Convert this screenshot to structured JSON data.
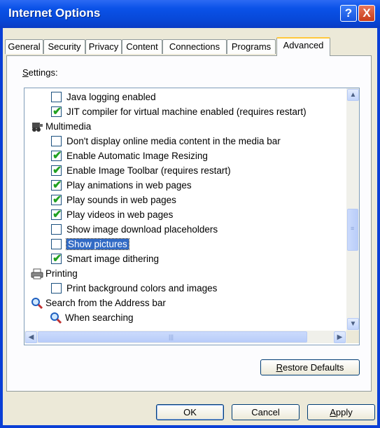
{
  "window": {
    "title": "Internet Options"
  },
  "titlebar_buttons": {
    "help": "?",
    "close": "X"
  },
  "tabs": [
    {
      "label": "General"
    },
    {
      "label": "Security"
    },
    {
      "label": "Privacy"
    },
    {
      "label": "Content"
    },
    {
      "label": "Connections"
    },
    {
      "label": "Programs"
    },
    {
      "label": "Advanced",
      "active": true
    }
  ],
  "settings_label": {
    "mnemonic": "S",
    "rest": "ettings:"
  },
  "tree": [
    {
      "type": "checkbox",
      "label": "Java logging enabled",
      "checked": false
    },
    {
      "type": "checkbox",
      "label": "JIT compiler for virtual machine enabled (requires restart)",
      "checked": true
    },
    {
      "type": "category",
      "label": "Multimedia",
      "icon": "multimedia-icon"
    },
    {
      "type": "checkbox",
      "label": "Don't display online media content in the media bar",
      "checked": false
    },
    {
      "type": "checkbox",
      "label": "Enable Automatic Image Resizing",
      "checked": true
    },
    {
      "type": "checkbox",
      "label": "Enable Image Toolbar (requires restart)",
      "checked": true
    },
    {
      "type": "checkbox",
      "label": "Play animations in web pages",
      "checked": true
    },
    {
      "type": "checkbox",
      "label": "Play sounds in web pages",
      "checked": true
    },
    {
      "type": "checkbox",
      "label": "Play videos in web pages",
      "checked": true
    },
    {
      "type": "checkbox",
      "label": "Show image download placeholders",
      "checked": false
    },
    {
      "type": "checkbox",
      "label": "Show pictures",
      "checked": false,
      "selected": true
    },
    {
      "type": "checkbox",
      "label": "Smart image dithering",
      "checked": true
    },
    {
      "type": "category",
      "label": "Printing",
      "icon": "printer-icon"
    },
    {
      "type": "checkbox",
      "label": "Print background colors and images",
      "checked": false
    },
    {
      "type": "category",
      "label": "Search from the Address bar",
      "icon": "magnifier-icon"
    },
    {
      "type": "subcategory",
      "label": "When searching",
      "icon": "magnifier-icon"
    }
  ],
  "buttons": {
    "restore_defaults": {
      "mnemonic": "R",
      "rest": "estore Defaults"
    },
    "ok": "OK",
    "cancel": "Cancel",
    "apply": {
      "mnemonic": "A",
      "rest": "pply"
    }
  },
  "colors": {
    "titlebar": "#0a52e8",
    "selection": "#316ac5",
    "check": "#21a121",
    "active_tab_accent": "#ffc83c"
  }
}
